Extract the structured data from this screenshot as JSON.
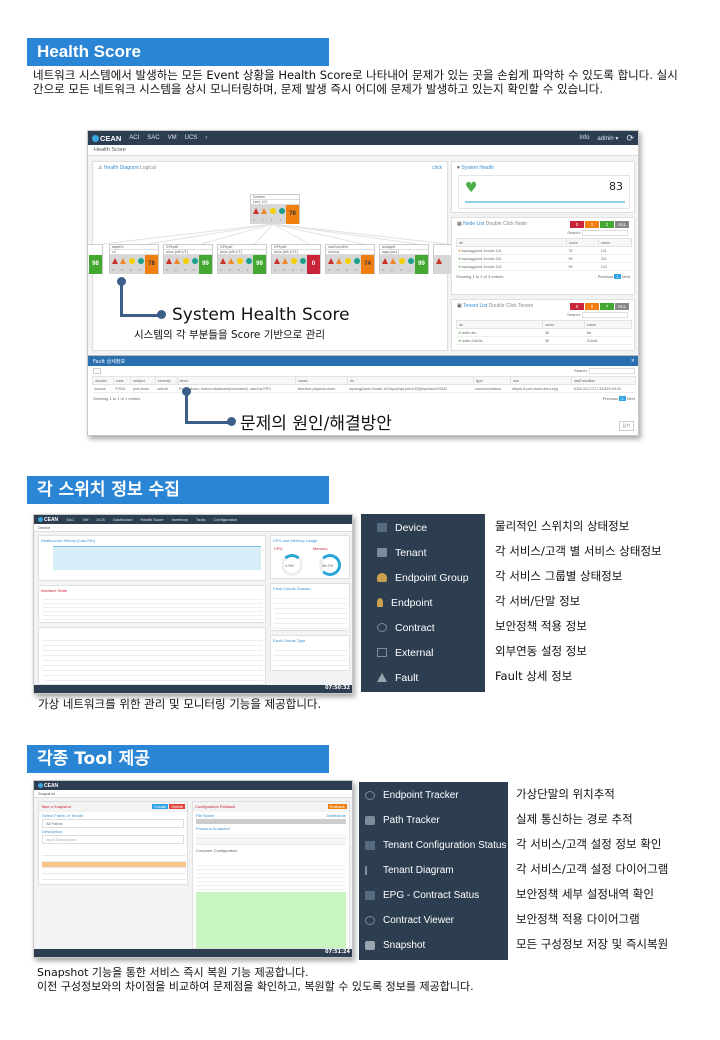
{
  "sections": [
    {
      "title": "Health Score",
      "description": "네트워크 시스템에서 발생하는 모든 Event 상황을 Health Score로 나타내어 문제가 있는 곳을 손쉽게 파악하 수 있도록 합니다. 실시간으로 모든 네트워크 시스템을 상시 모니터링하며, 문제 발생 즉시 어디에 문제가 발생하고 있는지 확인할 수 있습니다.",
      "screenshot": {
        "brand": "CEAN",
        "nav": [
          "ACI",
          "SAC",
          "VM",
          "UCS",
          "›"
        ],
        "user_info": "Info",
        "user_name": "admin ▾",
        "page_title": "Health Score",
        "diagram_title": "Health Diagram",
        "diagram_sub": "Logical",
        "diagram_link": "click",
        "root_node": {
          "line1": "System",
          "line2": "Leaf_101",
          "counts": "1 1 1 1",
          "score": "78",
          "level": "orange"
        },
        "child_nodes": [
          {
            "line1": "",
            "line2": "",
            "counts": "",
            "score": "98",
            "level": "green"
          },
          {
            "line1": "eqptCh",
            "line2": "ch",
            "counts": "0 0 0 0",
            "score": "78",
            "level": "orange"
          },
          {
            "line1": "l1PhysIf",
            "line2": "phys-[eth1/3]",
            "counts": "0 0 0 2",
            "score": "99",
            "level": "green"
          },
          {
            "line1": "l1PhysIf",
            "line2": "phys-[eth1/7]",
            "counts": "0 0 0 1",
            "score": "99",
            "level": "green"
          },
          {
            "line1": "l1PhysIf",
            "line2": "phys-[eth1/13]",
            "counts": "1 0 0 0",
            "score": "0",
            "level": "red"
          },
          {
            "line1": "nwsConnEnt",
            "line2": "comng",
            "counts": "0 0 0 0",
            "score": "74",
            "level": "orange"
          },
          {
            "line1": "pcAggrIf",
            "line2": "aggr-[po1]",
            "counts": "0 0 0 1",
            "score": "99",
            "level": "green"
          }
        ],
        "system_health": {
          "title": "System Health",
          "score": "83"
        },
        "node_list": {
          "title": "Node List",
          "hint": "Double Click Node",
          "filters": [
            "0",
            "1",
            "2",
            "ALL"
          ],
          "search_label": "Search:",
          "columns": [
            "dn",
            "score",
            "name"
          ],
          "rows": [
            {
              "dn": "topology/pod-1/node-101",
              "score": "78",
              "name": "101"
            },
            {
              "dn": "topology/pod-1/node-201",
              "score": "99",
              "name": "201"
            },
            {
              "dn": "topology/pod-1/node-102",
              "score": "99",
              "name": "102"
            }
          ],
          "footer": "Showing 1 to 3 of 3 entries",
          "pager": [
            "Previous",
            "1",
            "Next"
          ]
        },
        "tenant_list": {
          "title": "Tenant List",
          "hint": "Double Click Tenant",
          "filters": [
            "0",
            "0",
            "7",
            "ALL"
          ],
          "search_label": "Search:",
          "columns": [
            "dn",
            "score",
            "name"
          ],
          "rows": [
            {
              "dn": "uni/tn-iks",
              "score": "98",
              "name": "iks"
            },
            {
              "dn": "uni/tn-CiArAL",
              "score": "98",
              "name": "CiArAL"
            }
          ]
        },
        "fault_modal": {
          "title": "Fault 상세정보",
          "search_label": "Search:",
          "columns": [
            "domain",
            "code",
            "subject",
            "severity",
            "descr",
            "cause",
            "dn",
            "type",
            "rule",
            "lastTransition"
          ],
          "rows": [
            [
              "access",
              "F0532",
              "port-down",
              "critical",
              "Port is down, reason:sfpAbsent(connected), used by EPG",
              "interface-physical-down",
              "topology/pod-1/node-101/sys/phys-[eth1/10]/phys/fault-F0532",
              "communications",
              "ethpm-if-port-down-infra-epg",
              "2018-03-17T17:33:833+09:00"
            ]
          ],
          "footer": "Showing 1 to 1 of 1 entries",
          "pager": [
            "Previous",
            "1",
            "Next"
          ],
          "close_label": "닫기"
        }
      },
      "callouts": [
        {
          "title": "System Health Score",
          "subtitle": "시스템의 각 부분들을 Score 기반으로 관리"
        },
        {
          "title": "문제의 원인/해결방안"
        }
      ]
    },
    {
      "title": "각 스위치 정보 수집",
      "caption": "가상 네트워크를 위한 관리 및 모니터링 기능을 제공합니다.",
      "screenshot": {
        "brand": "CEAN",
        "nav": [
          "ACI",
          "SAC",
          "VM",
          "UCS",
          "›",
          "Dashboard",
          "Health Score",
          "Inventory",
          "Tools",
          "Configuration"
        ],
        "page_title": "Device",
        "chart_title": "Healthscore History (Last 24h)",
        "interface_title": "Interface State",
        "cpu_mem_title": "CPU and Memory Usage",
        "cpu_label": "CPU",
        "cpu_value": "4.5%",
        "memory_label": "Memory",
        "memory_value": "56.2%",
        "fault_domain_title": "Fault Counts Domain",
        "fault_type_title": "Fault Counts Type",
        "clock": "07:50:32"
      },
      "menu": [
        {
          "icon": "server-icon",
          "label": "Device",
          "desc": "물리적인 스위치의 상태정보"
        },
        {
          "icon": "share-icon",
          "label": "Tenant",
          "desc": "각 서비스/고객 별 서비스 상태정보"
        },
        {
          "icon": "users-icon",
          "label": "Endpoint Group",
          "desc": "각 서비스 그룹별 상태정보"
        },
        {
          "icon": "user-icon",
          "label": "Endpoint",
          "desc": "각 서버/단말 정보"
        },
        {
          "icon": "handshake-icon",
          "label": "Contract",
          "desc": "보안정책 적용 정보"
        },
        {
          "icon": "external-link-icon",
          "label": "External",
          "desc": "외부연동 설정 정보"
        },
        {
          "icon": "warning-icon",
          "label": "Fault",
          "desc": "Fault 상세 정보"
        }
      ]
    },
    {
      "title": "각종 Tool 제공",
      "caption_lines": [
        "Snapshot 기능을 통한 서비스 즉시 복원 기능 제공합니다.",
        "이전 구성정보와의 차이점을 비교하여 문제점을 확인하고, 복원할 수 있도록 정보를 제공합니다."
      ],
      "screenshot": {
        "brand": "CEAN",
        "page_title": "Snapshot",
        "left_panel_title": "Take a Snapshot",
        "create_label": "Create",
        "delete_label": "Delete",
        "select_label": "Select Fabric or Tenant",
        "select_value": "All Fabric",
        "description_label": "Description",
        "description_placeholder": "Input Description",
        "right_panel_title": "Configuration Rollback",
        "rollback_label": "Rollback",
        "file_name_label": "File Name",
        "datetime_label": "DateNAme",
        "previous_label": "Previous Snapshot",
        "compare_label": "Compare Configuration",
        "clock": "07:51:24"
      },
      "menu": [
        {
          "icon": "user-circle-icon",
          "label": "Endpoint Tracker",
          "desc": "가상단말의 위치추적"
        },
        {
          "icon": "binoculars-icon",
          "label": "Path Tracker",
          "desc": "실제 통신하는 경로 추적"
        },
        {
          "icon": "table-icon",
          "label": "Tenant Configuration Status",
          "desc": "각 서비스/고객 설정 정보 확인"
        },
        {
          "icon": "sitemap-icon",
          "label": "Tenant Diagram",
          "desc": "각 서비스/고객 설정 다이어그램"
        },
        {
          "icon": "table-icon",
          "label": "EPG - Contract Satus",
          "desc": "보안정책 세부 설정내역 확인"
        },
        {
          "icon": "copyright-icon",
          "label": "Contract Viewer",
          "desc": "보안정책 적용 다이어그램"
        },
        {
          "icon": "camera-icon",
          "label": "Snapshot",
          "desc": "모든 구성정보 저장 및 즉시복원"
        }
      ]
    }
  ],
  "colors": {
    "section_blue": "#2a86d4",
    "menu_bg": "#2c3e50",
    "score_green": "#43a832",
    "score_orange": "#f07f10",
    "score_red": "#c9243a",
    "callout_line": "#3c5f8a"
  }
}
